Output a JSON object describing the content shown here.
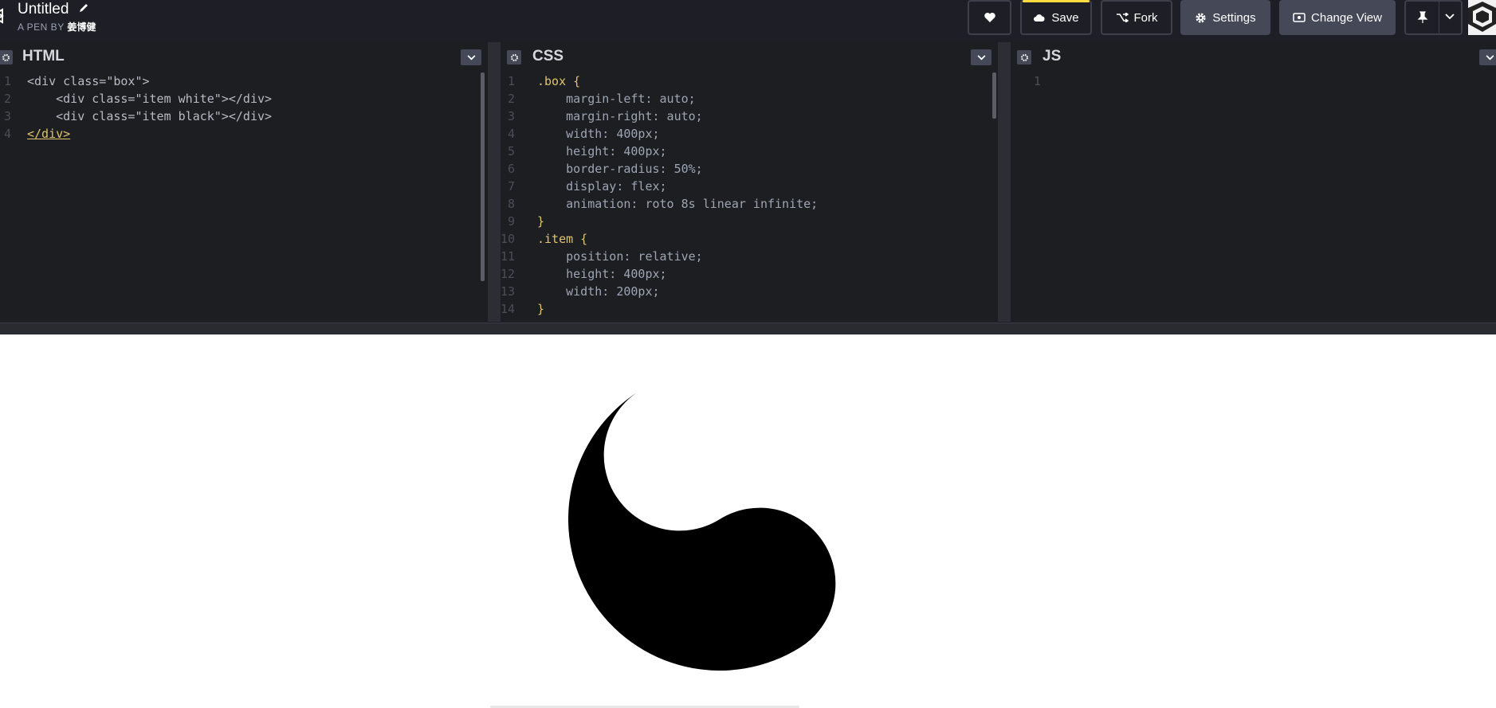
{
  "header": {
    "title": "Untitled",
    "subtitle_prefix": "A PEN BY",
    "author": "姜博健"
  },
  "toolbar": {
    "like_icon": "heart-icon",
    "save_label": "Save",
    "fork_label": "Fork",
    "settings_label": "Settings",
    "change_view_label": "Change View",
    "pin_icon": "pin-icon"
  },
  "panels": [
    {
      "title": "HTML"
    },
    {
      "title": "CSS"
    },
    {
      "title": "JS"
    }
  ],
  "html_code": [
    {
      "n": "1",
      "text": "<div class=\"box\">"
    },
    {
      "n": "2",
      "text": "    <div class=\"item white\"></div>"
    },
    {
      "n": "3",
      "text": "    <div class=\"item black\"></div>"
    },
    {
      "n": "4",
      "text": "</div>"
    }
  ],
  "css_code": [
    {
      "n": "1",
      "text": ".box {"
    },
    {
      "n": "2",
      "text": "    margin-left: auto;"
    },
    {
      "n": "3",
      "text": "    margin-right: auto;"
    },
    {
      "n": "4",
      "text": "    width: 400px;"
    },
    {
      "n": "5",
      "text": "    height: 400px;"
    },
    {
      "n": "6",
      "text": "    border-radius: 50%;"
    },
    {
      "n": "7",
      "text": "    display: flex;"
    },
    {
      "n": "8",
      "text": "    animation: roto 8s linear infinite;"
    },
    {
      "n": "9",
      "text": "}"
    },
    {
      "n": "10",
      "text": ".item {"
    },
    {
      "n": "11",
      "text": "    position: relative;"
    },
    {
      "n": "12",
      "text": "    height: 400px;"
    },
    {
      "n": "13",
      "text": "    width: 200px;"
    },
    {
      "n": "14",
      "text": "}"
    }
  ],
  "js_code": [
    {
      "n": "1",
      "text": ""
    }
  ],
  "colors": {
    "save_accent": "#ffdd40",
    "background": "#1e1f26",
    "preview_bg": "#ffffff"
  }
}
